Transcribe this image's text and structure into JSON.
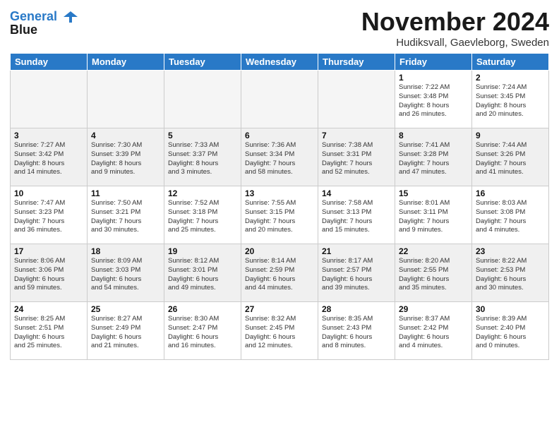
{
  "logo": {
    "line1": "General",
    "line2": "Blue"
  },
  "title": "November 2024",
  "subtitle": "Hudiksvall, Gaevleborg, Sweden",
  "days": [
    "Sunday",
    "Monday",
    "Tuesday",
    "Wednesday",
    "Thursday",
    "Friday",
    "Saturday"
  ],
  "weeks": [
    [
      {
        "day": "",
        "empty": true
      },
      {
        "day": "",
        "empty": true
      },
      {
        "day": "",
        "empty": true
      },
      {
        "day": "",
        "empty": true
      },
      {
        "day": "",
        "empty": true
      },
      {
        "day": "1",
        "text": "Sunrise: 7:22 AM\nSunset: 3:48 PM\nDaylight: 8 hours\nand 26 minutes."
      },
      {
        "day": "2",
        "text": "Sunrise: 7:24 AM\nSunset: 3:45 PM\nDaylight: 8 hours\nand 20 minutes."
      }
    ],
    [
      {
        "day": "3",
        "text": "Sunrise: 7:27 AM\nSunset: 3:42 PM\nDaylight: 8 hours\nand 14 minutes."
      },
      {
        "day": "4",
        "text": "Sunrise: 7:30 AM\nSunset: 3:39 PM\nDaylight: 8 hours\nand 9 minutes."
      },
      {
        "day": "5",
        "text": "Sunrise: 7:33 AM\nSunset: 3:37 PM\nDaylight: 8 hours\nand 3 minutes."
      },
      {
        "day": "6",
        "text": "Sunrise: 7:36 AM\nSunset: 3:34 PM\nDaylight: 7 hours\nand 58 minutes."
      },
      {
        "day": "7",
        "text": "Sunrise: 7:38 AM\nSunset: 3:31 PM\nDaylight: 7 hours\nand 52 minutes."
      },
      {
        "day": "8",
        "text": "Sunrise: 7:41 AM\nSunset: 3:28 PM\nDaylight: 7 hours\nand 47 minutes."
      },
      {
        "day": "9",
        "text": "Sunrise: 7:44 AM\nSunset: 3:26 PM\nDaylight: 7 hours\nand 41 minutes."
      }
    ],
    [
      {
        "day": "10",
        "text": "Sunrise: 7:47 AM\nSunset: 3:23 PM\nDaylight: 7 hours\nand 36 minutes."
      },
      {
        "day": "11",
        "text": "Sunrise: 7:50 AM\nSunset: 3:21 PM\nDaylight: 7 hours\nand 30 minutes."
      },
      {
        "day": "12",
        "text": "Sunrise: 7:52 AM\nSunset: 3:18 PM\nDaylight: 7 hours\nand 25 minutes."
      },
      {
        "day": "13",
        "text": "Sunrise: 7:55 AM\nSunset: 3:15 PM\nDaylight: 7 hours\nand 20 minutes."
      },
      {
        "day": "14",
        "text": "Sunrise: 7:58 AM\nSunset: 3:13 PM\nDaylight: 7 hours\nand 15 minutes."
      },
      {
        "day": "15",
        "text": "Sunrise: 8:01 AM\nSunset: 3:11 PM\nDaylight: 7 hours\nand 9 minutes."
      },
      {
        "day": "16",
        "text": "Sunrise: 8:03 AM\nSunset: 3:08 PM\nDaylight: 7 hours\nand 4 minutes."
      }
    ],
    [
      {
        "day": "17",
        "text": "Sunrise: 8:06 AM\nSunset: 3:06 PM\nDaylight: 6 hours\nand 59 minutes."
      },
      {
        "day": "18",
        "text": "Sunrise: 8:09 AM\nSunset: 3:03 PM\nDaylight: 6 hours\nand 54 minutes."
      },
      {
        "day": "19",
        "text": "Sunrise: 8:12 AM\nSunset: 3:01 PM\nDaylight: 6 hours\nand 49 minutes."
      },
      {
        "day": "20",
        "text": "Sunrise: 8:14 AM\nSunset: 2:59 PM\nDaylight: 6 hours\nand 44 minutes."
      },
      {
        "day": "21",
        "text": "Sunrise: 8:17 AM\nSunset: 2:57 PM\nDaylight: 6 hours\nand 39 minutes."
      },
      {
        "day": "22",
        "text": "Sunrise: 8:20 AM\nSunset: 2:55 PM\nDaylight: 6 hours\nand 35 minutes."
      },
      {
        "day": "23",
        "text": "Sunrise: 8:22 AM\nSunset: 2:53 PM\nDaylight: 6 hours\nand 30 minutes."
      }
    ],
    [
      {
        "day": "24",
        "text": "Sunrise: 8:25 AM\nSunset: 2:51 PM\nDaylight: 6 hours\nand 25 minutes."
      },
      {
        "day": "25",
        "text": "Sunrise: 8:27 AM\nSunset: 2:49 PM\nDaylight: 6 hours\nand 21 minutes."
      },
      {
        "day": "26",
        "text": "Sunrise: 8:30 AM\nSunset: 2:47 PM\nDaylight: 6 hours\nand 16 minutes."
      },
      {
        "day": "27",
        "text": "Sunrise: 8:32 AM\nSunset: 2:45 PM\nDaylight: 6 hours\nand 12 minutes."
      },
      {
        "day": "28",
        "text": "Sunrise: 8:35 AM\nSunset: 2:43 PM\nDaylight: 6 hours\nand 8 minutes."
      },
      {
        "day": "29",
        "text": "Sunrise: 8:37 AM\nSunset: 2:42 PM\nDaylight: 6 hours\nand 4 minutes."
      },
      {
        "day": "30",
        "text": "Sunrise: 8:39 AM\nSunset: 2:40 PM\nDaylight: 6 hours\nand 0 minutes."
      }
    ]
  ]
}
